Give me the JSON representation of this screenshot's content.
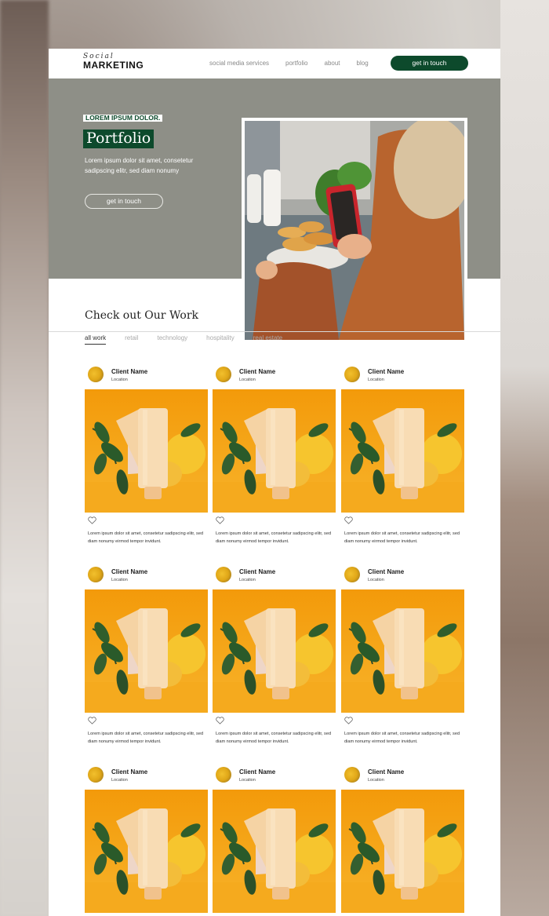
{
  "nav": {
    "logo_script": "Social",
    "logo_main": "MARKETING",
    "links": [
      "social media services",
      "portfolio",
      "about",
      "blog"
    ],
    "cta": "get in touch"
  },
  "hero": {
    "kicker": "LOREM IPSUM DOLOR.",
    "title": "Portfolio",
    "description": "Lorem ipsum dolor sit amet, consetetur sadipscing elitr, sed diam nonumy",
    "button": "get in touch"
  },
  "work": {
    "title": "Check out Our Work",
    "tabs": [
      "all work",
      "retail",
      "technology",
      "hospitality",
      "real estate"
    ],
    "active_tab": "all work",
    "cards": [
      {
        "name": "Client Name",
        "location": "Location",
        "text": "Lorem ipsum dolor sit amet, consetetur sadipscing elitr, sed diam nonumy eirmod tempor invidunt."
      },
      {
        "name": "Client Name",
        "location": "Location",
        "text": "Lorem ipsum dolor sit amet, consetetur sadipscing elitr, sed diam nonumy eirmod tempor invidunt."
      },
      {
        "name": "Client Name",
        "location": "Location",
        "text": "Lorem ipsum dolor sit amet, consetetur sadipscing elitr, sed diam nonumy eirmod tempor invidunt."
      },
      {
        "name": "Client Name",
        "location": "Location",
        "text": "Lorem ipsum dolor sit amet, consetetur sadipscing elitr, sed diam nonumy eirmod tempor invidunt."
      },
      {
        "name": "Client Name",
        "location": "Location",
        "text": "Lorem ipsum dolor sit amet, consetetur sadipscing elitr, sed diam nonumy eirmod tempor invidunt."
      },
      {
        "name": "Client Name",
        "location": "Location",
        "text": "Lorem ipsum dolor sit amet, consetetur sadipscing elitr, sed diam nonumy eirmod tempor invidunt."
      },
      {
        "name": "Client Name",
        "location": "Location",
        "text": ""
      },
      {
        "name": "Client Name",
        "location": "Location",
        "text": ""
      },
      {
        "name": "Client Name",
        "location": "Location",
        "text": ""
      }
    ]
  },
  "colors": {
    "brand_green": "#0d4a2c",
    "hero_bg": "#8e8f87",
    "product_orange": "#f2a20c"
  },
  "icons": {
    "heart": "heart-outline-icon"
  }
}
